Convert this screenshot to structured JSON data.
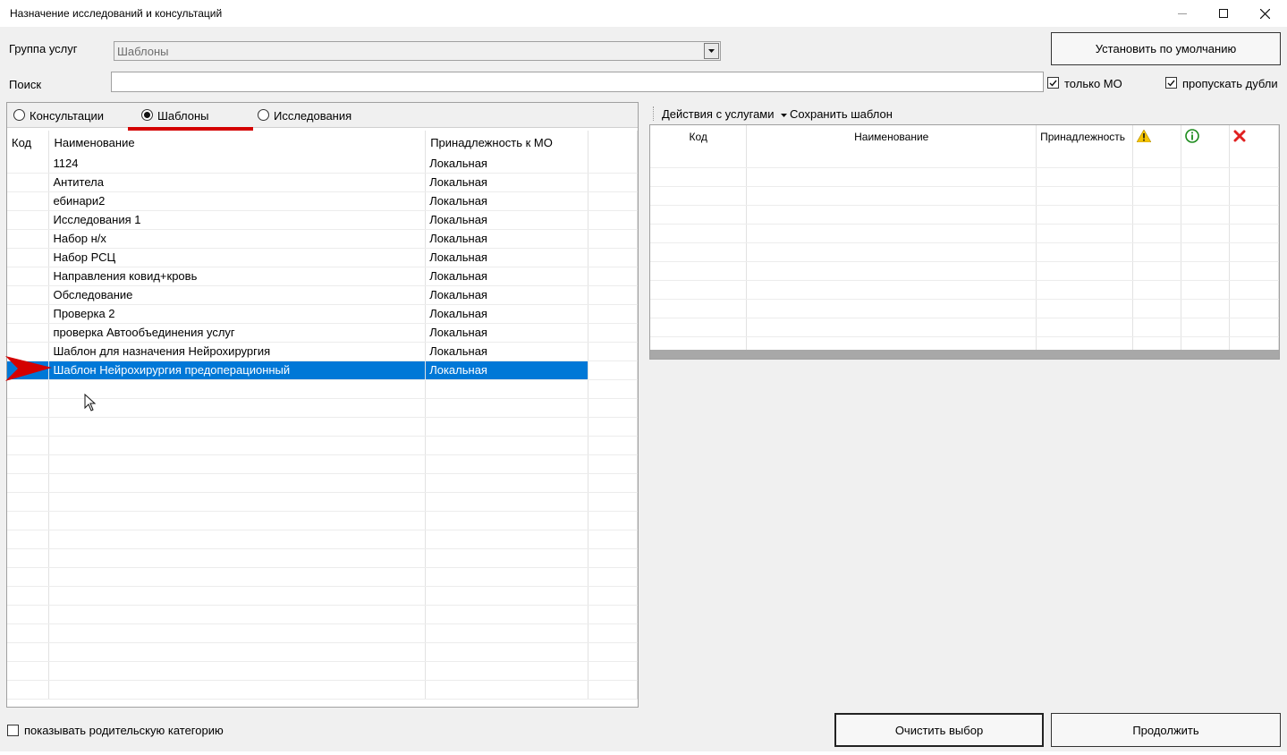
{
  "window": {
    "title": "Назначение исследований и консультаций",
    "controls": {
      "minimize": "—",
      "maximize": "☐",
      "close": "✕"
    }
  },
  "form": {
    "group_label": "Группа услуг",
    "group_value": "Шаблоны",
    "set_default_button": "Установить по умолчанию",
    "search_label": "Поиск",
    "search_value": "",
    "only_mo_label": "только МО",
    "only_mo_checked": true,
    "skip_dupes_label": "пропускать дубли",
    "skip_dupes_checked": true
  },
  "tabs": {
    "consult": "Консультации",
    "templates": "Шаблоны",
    "research": "Исследования",
    "selected": "templates"
  },
  "left_grid": {
    "columns": [
      "Код",
      "Наименование",
      "Принадлежность к МО"
    ],
    "rows": [
      {
        "code": "",
        "name": "1124",
        "owner": "Локальная"
      },
      {
        "code": "",
        "name": "Антитела",
        "owner": "Локальная"
      },
      {
        "code": "",
        "name": "ебинари2",
        "owner": "Локальная"
      },
      {
        "code": "",
        "name": "Исследования 1",
        "owner": "Локальная"
      },
      {
        "code": "",
        "name": "Набор н/х",
        "owner": "Локальная"
      },
      {
        "code": "",
        "name": "Набор РСЦ",
        "owner": "Локальная"
      },
      {
        "code": "",
        "name": "Направления ковид+кровь",
        "owner": "Локальная"
      },
      {
        "code": "",
        "name": "Обследование",
        "owner": "Локальная"
      },
      {
        "code": "",
        "name": "Проверка 2",
        "owner": "Локальная"
      },
      {
        "code": "",
        "name": "проверка Автообъединения услуг",
        "owner": "Локальная"
      },
      {
        "code": "",
        "name": "Шаблон для назначения Нейрохирургия",
        "owner": "Локальная"
      },
      {
        "code": "",
        "name": "Шаблон Нейрохирургия предоперационный",
        "owner": "Локальная"
      }
    ],
    "selected_index": 11
  },
  "right_toolbar": {
    "actions_menu": "Действия с услугами",
    "save_template": "Сохранить шаблон"
  },
  "right_grid": {
    "columns": [
      "Код",
      "Наименование",
      "Принадлежность"
    ],
    "icons": [
      "warning-icon",
      "info-icon",
      "delete-icon"
    ]
  },
  "footer": {
    "show_parent_label": "показывать родительскую категорию",
    "show_parent_checked": false,
    "clear_button": "Очистить выбор",
    "continue_button": "Продолжить"
  },
  "colors": {
    "selection": "#0078d7",
    "annotation_red": "#d40000"
  }
}
